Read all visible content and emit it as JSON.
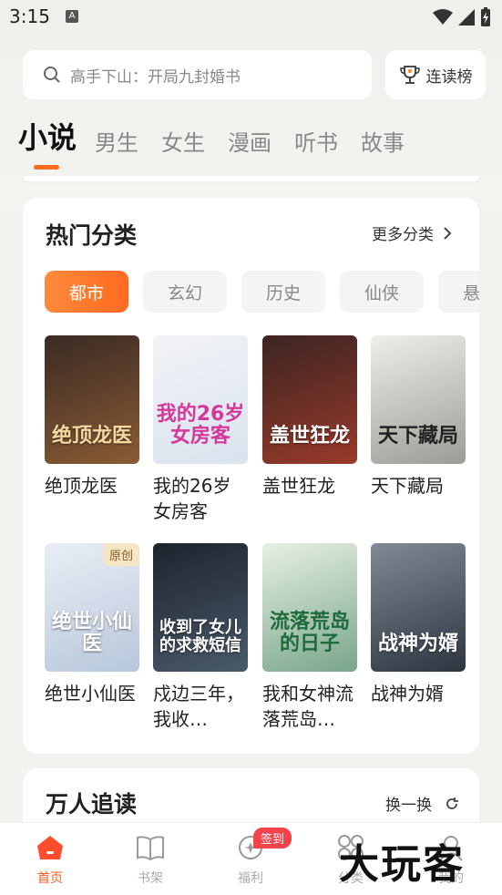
{
  "status": {
    "time": "3:15"
  },
  "search": {
    "placeholder": "高手下山：开局九封婚书",
    "rank_label": "连读榜"
  },
  "tabs": [
    {
      "label": "小说",
      "active": true
    },
    {
      "label": "男生"
    },
    {
      "label": "女生"
    },
    {
      "label": "漫画"
    },
    {
      "label": "听书"
    },
    {
      "label": "故事"
    }
  ],
  "hot": {
    "title": "热门分类",
    "more": "更多分类",
    "chips": [
      "都市",
      "玄幻",
      "历史",
      "仙侠",
      "悬疑"
    ],
    "books": [
      {
        "title": "绝顶龙医",
        "cover_text": "绝顶龙医",
        "colors": [
          "#3a2a24",
          "#8a5b34"
        ]
      },
      {
        "title": "我的26岁女房客",
        "cover_text": "我的26岁女房客",
        "colors": [
          "#f2f3f6",
          "#d9e3ee"
        ]
      },
      {
        "title": "盖世狂龙",
        "cover_text": "盖世狂龙",
        "colors": [
          "#3b2422",
          "#9a3a2a"
        ]
      },
      {
        "title": "天下藏局",
        "cover_text": "天下藏局",
        "colors": [
          "#efefe9",
          "#9c9c96"
        ]
      },
      {
        "title": "绝世小仙医",
        "cover_text": "绝世小仙医",
        "badge": "原创",
        "colors": [
          "#e9eef5",
          "#b8c7dc"
        ]
      },
      {
        "title": "戍边三年，我收到了女儿的求救短信",
        "title_display": "戍边三年，我收…",
        "cover_text": "收到了女儿的求救短信",
        "colors": [
          "#1d232d",
          "#4a5a6a"
        ]
      },
      {
        "title": "我和女神流落荒岛的日子",
        "title_display": "我和女神流落荒岛…",
        "cover_text": "流落荒岛的日子",
        "colors": [
          "#e7f0e6",
          "#79a58a"
        ]
      },
      {
        "title": "战神为婿",
        "cover_text": "战神为婿",
        "colors": [
          "#7f8a94",
          "#2d3640"
        ]
      }
    ]
  },
  "popular": {
    "title": "万人追读",
    "refresh": "换一换"
  },
  "nav": {
    "items": [
      {
        "label": "首页",
        "active": true
      },
      {
        "label": "书架"
      },
      {
        "label": "福利"
      },
      {
        "label": "分类"
      },
      {
        "label": "我的"
      }
    ],
    "badge": "签到"
  },
  "watermark": "大玩客",
  "accent": "#ff6a1f"
}
